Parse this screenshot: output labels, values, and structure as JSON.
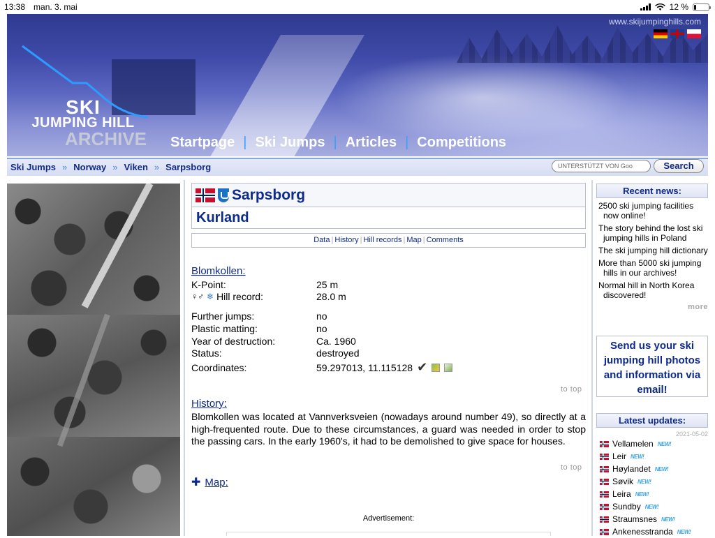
{
  "statusbar": {
    "time": "13:38",
    "date": "man. 3. mai",
    "battery": "12 %"
  },
  "header": {
    "url": "www.skijumpinghills.com",
    "logo": {
      "line1": "SKI",
      "line2": "JUMPING HILL",
      "line3": "ARCHIVE"
    },
    "nav": [
      "Startpage",
      "Ski Jumps",
      "Articles",
      "Competitions"
    ],
    "nav_separator": "|"
  },
  "breadcrumb": [
    "Ski Jumps",
    "Norway",
    "Viken",
    "Sarpsborg"
  ],
  "breadcrumb_separator": "»",
  "search": {
    "placeholder": "UNTERSTÜTZT VON Goo",
    "button": "Search"
  },
  "title": {
    "city": "Sarpsborg",
    "hill": "Kurland"
  },
  "tabs": [
    "Data",
    "History",
    "Hill records",
    "Map",
    "Comments"
  ],
  "data_section": {
    "heading": "Blomkollen:",
    "rows": [
      {
        "label": "K-Point:",
        "value": "25 m"
      },
      {
        "label": "Hill record:",
        "value": "28.0 m"
      },
      {
        "label": "Further jumps:",
        "value": "no"
      },
      {
        "label": "Plastic matting:",
        "value": "no"
      },
      {
        "label": "Year of destruction:",
        "value": "Ca. 1960"
      },
      {
        "label": "Status:",
        "value": "destroyed"
      },
      {
        "label": "Coordinates:",
        "value": "59.297013, 11.115128"
      }
    ]
  },
  "to_top": "to top",
  "history": {
    "heading": "History:",
    "text": "Blomkollen was located at Vannverksveien (nowadays around number 49), so directly at a high-frequented route. Due to these circumstances, a guard was needed in order to stop the passing cars. In the early 1960's, it had to be demolished to give space for houses."
  },
  "map_heading": "Map:",
  "advertisement": "Advertisement:",
  "sidebar": {
    "recent_news_title": "Recent news:",
    "news": [
      "2500 ski jumping facilities now online!",
      "The story behind the lost ski jumping hills in Poland",
      "The ski jumping hill dictionary",
      "More than 5000 ski jumping hills in our archives!",
      "Normal hill in North Korea discovered!"
    ],
    "more": "more",
    "send_text": "Send us your ski jumping hill photos and information via email!",
    "latest_title": "Latest updates:",
    "latest_date": "2021-05-02",
    "updates": [
      "Vellamelen",
      "Leir",
      "Høylandet",
      "Søvik",
      "Leira",
      "Sundby",
      "Straumsnes",
      "Ankenesstranda"
    ],
    "new_badge": "NEW!"
  }
}
